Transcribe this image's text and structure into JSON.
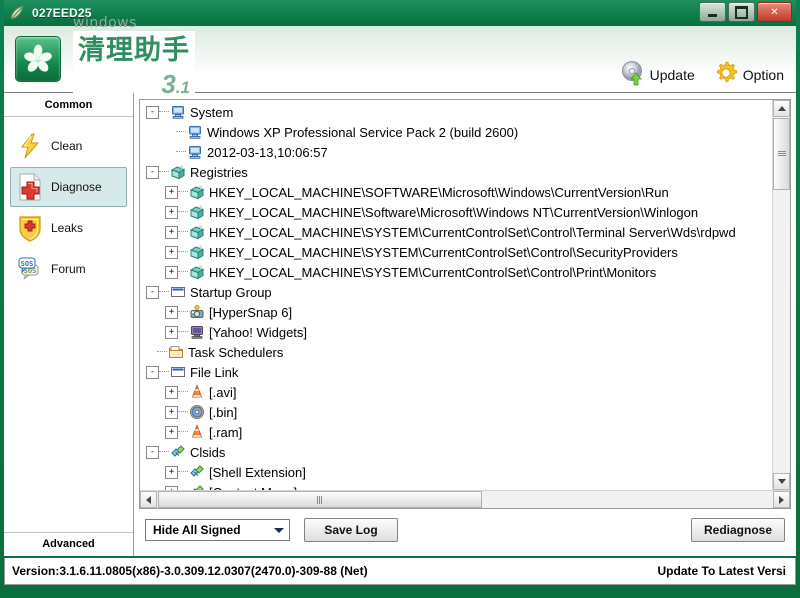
{
  "window": {
    "title": "027EED25",
    "icon": "leaf-icon",
    "buttons": {
      "minimize": "minimize-icon",
      "maximize": "maximize-icon",
      "close": "✕"
    }
  },
  "header": {
    "brand_sub": "windows",
    "brand_cn": "清理助手",
    "version_major": "3",
    "version_dot": ".",
    "version_minor": "1",
    "actions": [
      {
        "label": "Update",
        "icon": "cd-update-icon"
      },
      {
        "label": "Option",
        "icon": "gear-icon"
      }
    ]
  },
  "sidebar": {
    "head": "Common",
    "foot": "Advanced",
    "items": [
      {
        "label": "Clean",
        "icon": "lightning-icon",
        "selected": false
      },
      {
        "label": "Diagnose",
        "icon": "red-cross-doc-icon",
        "selected": true
      },
      {
        "label": "Leaks",
        "icon": "shield-cross-icon",
        "selected": false
      },
      {
        "label": "Forum",
        "icon": "sos-bubble-icon",
        "selected": false
      }
    ]
  },
  "tree": {
    "nodes": [
      {
        "depth": 0,
        "expander": "-",
        "icon": "computer-icon",
        "label": "System"
      },
      {
        "depth": 1,
        "expander": "",
        "icon": "computer-icon",
        "label": "Windows XP Professional Service Pack 2 (build 2600)"
      },
      {
        "depth": 1,
        "expander": "",
        "icon": "computer-icon",
        "label": "2012-03-13,10:06:57"
      },
      {
        "depth": 0,
        "expander": "-",
        "icon": "registry-icon",
        "label": "Registries"
      },
      {
        "depth": 1,
        "expander": "+",
        "icon": "registry-icon",
        "label": "HKEY_LOCAL_MACHINE\\SOFTWARE\\Microsoft\\Windows\\CurrentVersion\\Run"
      },
      {
        "depth": 1,
        "expander": "+",
        "icon": "registry-icon",
        "label": "HKEY_LOCAL_MACHINE\\Software\\Microsoft\\Windows NT\\CurrentVersion\\Winlogon"
      },
      {
        "depth": 1,
        "expander": "+",
        "icon": "registry-icon",
        "label": "HKEY_LOCAL_MACHINE\\SYSTEM\\CurrentControlSet\\Control\\Terminal Server\\Wds\\rdpwd"
      },
      {
        "depth": 1,
        "expander": "+",
        "icon": "registry-icon",
        "label": "HKEY_LOCAL_MACHINE\\SYSTEM\\CurrentControlSet\\Control\\SecurityProviders"
      },
      {
        "depth": 1,
        "expander": "+",
        "icon": "registry-icon",
        "label": "HKEY_LOCAL_MACHINE\\SYSTEM\\CurrentControlSet\\Control\\Print\\Monitors"
      },
      {
        "depth": 0,
        "expander": "-",
        "icon": "window-icon",
        "label": "Startup Group"
      },
      {
        "depth": 1,
        "expander": "+",
        "icon": "hypersnap-icon",
        "label": "[HyperSnap 6]"
      },
      {
        "depth": 1,
        "expander": "+",
        "icon": "yahoo-icon",
        "label": "[Yahoo! Widgets]"
      },
      {
        "depth": 0,
        "expander": "",
        "icon": "folder-icon",
        "label": "Task Schedulers"
      },
      {
        "depth": 0,
        "expander": "-",
        "icon": "window-icon",
        "label": "File Link"
      },
      {
        "depth": 1,
        "expander": "+",
        "icon": "vlc-cone-icon",
        "label": "[.avi]"
      },
      {
        "depth": 1,
        "expander": "+",
        "icon": "disc-icon",
        "label": "[.bin]"
      },
      {
        "depth": 1,
        "expander": "+",
        "icon": "vlc-cone-icon",
        "label": "[.ram]"
      },
      {
        "depth": 0,
        "expander": "-",
        "icon": "clsid-icon",
        "label": "Clsids"
      },
      {
        "depth": 1,
        "expander": "+",
        "icon": "clsid-icon",
        "label": "[Shell Extension]"
      },
      {
        "depth": 1,
        "expander": "+",
        "icon": "clsid-icon",
        "label": "[Context Menu]"
      }
    ]
  },
  "toolbar": {
    "filter_value": "Hide All Signed",
    "filter_options": [
      "Hide All Signed"
    ],
    "save_log_label": "Save Log",
    "rediagnose_label": "Rediagnose"
  },
  "status": {
    "version": "Version:3.1.6.11.0805(x86)-3.0.309.12.0307(2470.0)-309-88 (Net)",
    "update": "Update To Latest Versi"
  },
  "colors": {
    "frame_green": "#0a7a45",
    "title_green": "#0c7f4c",
    "selection_blue": "#d6eaea",
    "accent_red": "#d8352a"
  }
}
